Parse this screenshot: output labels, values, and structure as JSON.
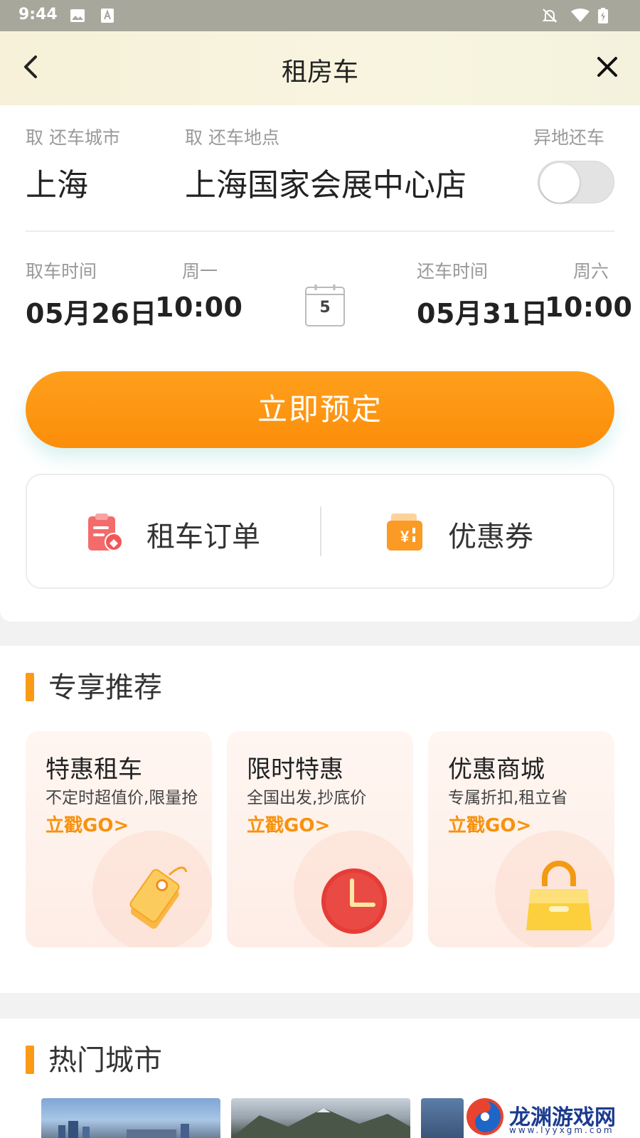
{
  "status_bar": {
    "time": "9:44"
  },
  "header": {
    "title": "租房车"
  },
  "pickup": {
    "city_label": "取 还车城市",
    "city": "上海",
    "location_label": "取 还车地点",
    "location": "上海国家会展中心店",
    "diff_return_label": "异地还车",
    "diff_return_enabled": false
  },
  "times": {
    "pickup_label": "取车时间",
    "pickup_weekday": "周一",
    "pickup_date": "05月26日",
    "pickup_time": "10:00",
    "days": "5",
    "return_label": "还车时间",
    "return_weekday": "周六",
    "return_date": "05月31日",
    "return_time": "10:00"
  },
  "book_button": "立即预定",
  "quick_links": {
    "orders": "租车订单",
    "coupons": "优惠券"
  },
  "recommend": {
    "title": "专享推荐",
    "cards": [
      {
        "title": "特惠租车",
        "subtitle": "不定时超值价,限量抢",
        "cta": "立戳GO>",
        "icon": "price-tag-icon"
      },
      {
        "title": "限时特惠",
        "subtitle": "全国出发,抄底价",
        "cta": "立戳GO>",
        "icon": "clock-icon"
      },
      {
        "title": "优惠商城",
        "subtitle": "专属折扣,租立省",
        "cta": "立戳GO>",
        "icon": "shopping-bag-icon"
      }
    ]
  },
  "hot_cities": {
    "title": "热门城市"
  },
  "watermark": {
    "name": "龙渊游戏网",
    "url": "www.lyyxgm.com"
  },
  "colors": {
    "accent": "#fb9a14",
    "button": "#fb8e0a",
    "cta": "#f7920e"
  }
}
